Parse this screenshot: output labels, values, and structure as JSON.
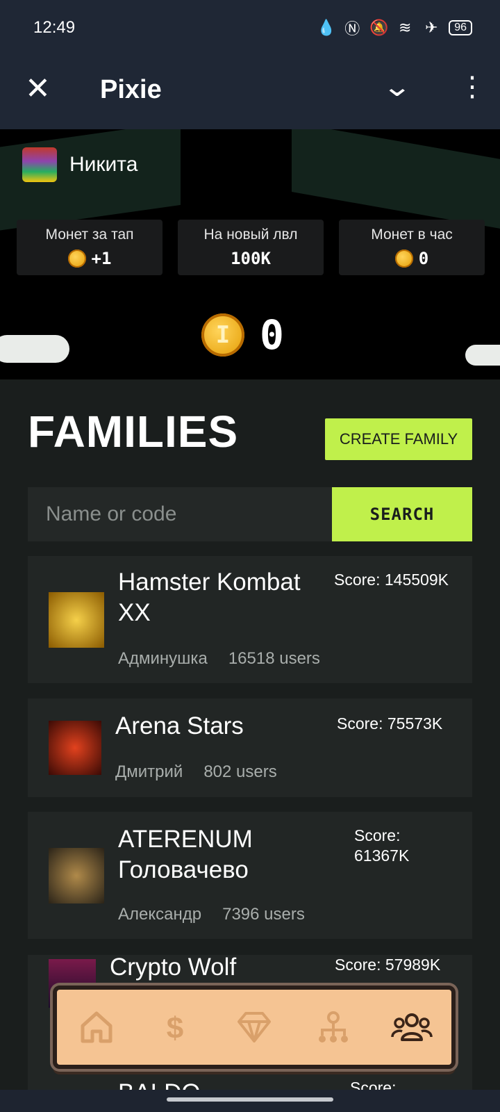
{
  "status_bar": {
    "time": "12:49",
    "battery": "96"
  },
  "app_bar": {
    "title": "Pixie"
  },
  "user": {
    "name": "Никита"
  },
  "stats": [
    {
      "label": "Монет за тап",
      "value": "+1",
      "has_coin": true
    },
    {
      "label": "На новый лвл",
      "value": "100K",
      "has_coin": false
    },
    {
      "label": "Монет в час",
      "value": "0",
      "has_coin": true
    }
  ],
  "balance": {
    "amount": "0"
  },
  "families": {
    "title": "FAMILIES",
    "create_label": "CREATE FAMILY",
    "search_placeholder": "Name or code",
    "search_label": "SEARCH",
    "items": [
      {
        "name_lines": [
          "Hamster Kombat",
          "XX"
        ],
        "score": "Score: 145509K",
        "owner": "Админушка",
        "users": "16518 users"
      },
      {
        "name_lines": [
          "Arena Stars"
        ],
        "score": "Score: 75573K",
        "owner": "Дмитрий",
        "users": "802 users"
      },
      {
        "name_lines": [
          "ATERENUM",
          "Головачево"
        ],
        "score": "Score: 61367K",
        "owner": "Александр",
        "users": "7396 users"
      },
      {
        "name_lines": [
          "Crypto Wolf"
        ],
        "score": "Score: 57989K",
        "owner": "",
        "users": ""
      },
      {
        "name_lines": [
          "BALDO"
        ],
        "score": "Score:",
        "owner": "",
        "users": ""
      }
    ]
  },
  "nav": [
    {
      "icon": "home-icon"
    },
    {
      "icon": "dollar-icon"
    },
    {
      "icon": "diamond-icon"
    },
    {
      "icon": "referral-tree-icon"
    },
    {
      "icon": "group-icon",
      "active": true
    }
  ],
  "colors": {
    "accent": "#c0f04b",
    "nav_bg": "#f5c493",
    "nav_icon": "#d9a06a",
    "nav_icon_active": "#3a2418"
  }
}
